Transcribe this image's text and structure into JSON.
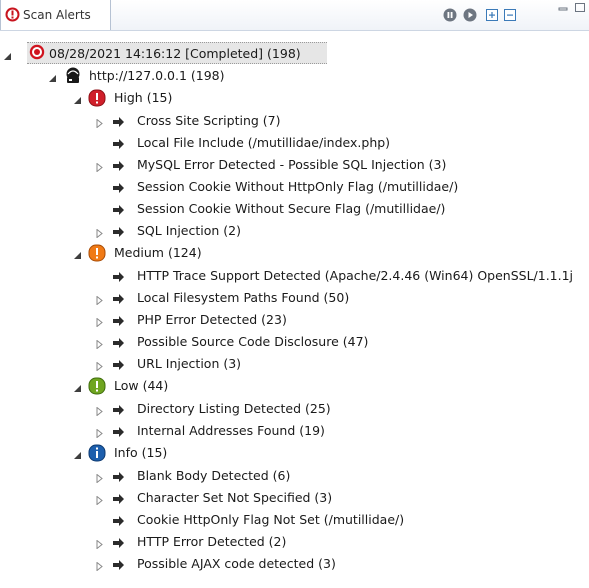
{
  "tab": {
    "label": "Scan Alerts",
    "icon": "target-alert-icon"
  },
  "toolbar": {
    "buttons": [
      "pause-icon",
      "play-icon",
      "expand-all-icon",
      "collapse-all-icon"
    ]
  },
  "tree": {
    "scan": {
      "label": "08/28/2021 14:16:12 [Completed]  (198)"
    },
    "host": {
      "label": "http://127.0.0.1 (198)"
    },
    "groups": {
      "high": {
        "label": "High (15)",
        "items": [
          "Cross Site Scripting (7)",
          "Local File Include (/mutillidae/index.php)",
          "MySQL Error Detected - Possible SQL Injection (3)",
          "Session Cookie Without HttpOnly Flag  (/mutillidae/)",
          "Session Cookie Without Secure Flag  (/mutillidae/)",
          "SQL Injection (2)"
        ]
      },
      "medium": {
        "label": "Medium (124)",
        "items": [
          "HTTP Trace Support Detected (Apache/2.4.46 (Win64) OpenSSL/1.1.1j",
          "Local Filesystem Paths Found (50)",
          "PHP Error Detected (23)",
          "Possible Source Code Disclosure (47)",
          "URL Injection (3)"
        ]
      },
      "low": {
        "label": "Low (44)",
        "items": [
          "Directory Listing Detected (25)",
          "Internal Addresses Found (19)"
        ]
      },
      "info": {
        "label": "Info (15)",
        "items": [
          "Blank Body Detected (6)",
          "Character Set Not Specified  (3)",
          "Cookie HttpOnly Flag Not Set  (/mutillidae/)",
          "HTTP Error Detected (2)",
          "Possible AJAX code detected (3)"
        ]
      }
    }
  },
  "colors": {
    "high": "#d01f2a",
    "medium": "#f07a16",
    "low": "#6fa520",
    "info": "#1d5fad",
    "selection": "#e6e6e6"
  }
}
